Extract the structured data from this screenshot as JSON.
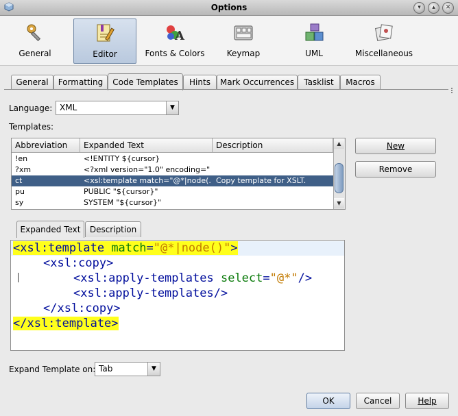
{
  "window": {
    "title": "Options"
  },
  "categories": [
    {
      "label": "General",
      "icon": "general-icon"
    },
    {
      "label": "Editor",
      "icon": "editor-icon",
      "selected": true
    },
    {
      "label": "Fonts & Colors",
      "icon": "fonts-colors-icon"
    },
    {
      "label": "Keymap",
      "icon": "keymap-icon"
    },
    {
      "label": "UML",
      "icon": "uml-icon"
    },
    {
      "label": "Miscellaneous",
      "icon": "miscellaneous-icon"
    }
  ],
  "tabs": [
    "General",
    "Formatting",
    "Code Templates",
    "Hints",
    "Mark Occurrences",
    "Tasklist",
    "Macros"
  ],
  "selected_tab": "Code Templates",
  "language": {
    "label": "Language:",
    "value": "XML"
  },
  "templates": {
    "label": "Templates:",
    "columns": [
      "Abbreviation",
      "Expanded Text",
      "Description"
    ],
    "rows": [
      {
        "abbr": "!en",
        "text": "<!ENTITY ${cursor}",
        "desc": ""
      },
      {
        "abbr": "?xm",
        "text": "<?xml version=\"1.0\" encoding=\"...",
        "desc": ""
      },
      {
        "abbr": "ct",
        "text": "<xsl:template match=\"@*|node(...",
        "desc": "Copy template for XSLT.",
        "selected": true
      },
      {
        "abbr": "pu",
        "text": "PUBLIC \"${cursor}\"",
        "desc": ""
      },
      {
        "abbr": "sy",
        "text": "SYSTEM \"${cursor}\"",
        "desc": ""
      }
    ]
  },
  "buttons": {
    "new": "New",
    "remove": "Remove",
    "ok": "OK",
    "cancel": "Cancel",
    "help": "Help"
  },
  "subtabs": [
    "Expanded Text",
    "Description"
  ],
  "code": {
    "l1_open": "<xsl:template",
    "l1_attr": "match",
    "l1_eq": "=",
    "l1_str": "\"@*|node()\"",
    "l1_close": ">",
    "l2": "<xsl:copy>",
    "l3_tag": "<xsl:apply-templates",
    "l3_attr": "select",
    "l3_eq": "=",
    "l3_str": "\"@*\"",
    "l3_close": "/>",
    "l4": "<xsl:apply-templates/>",
    "l5": "</xsl:copy>",
    "l6": "</xsl:template>"
  },
  "expand_on": {
    "label": "Expand Template on:",
    "value": "Tab"
  },
  "colors": {
    "highlight": "#ffff1c",
    "selection": "#3f5f87",
    "tag": "#000d9c",
    "attr": "#0a7a0a",
    "string": "#c27a00"
  }
}
